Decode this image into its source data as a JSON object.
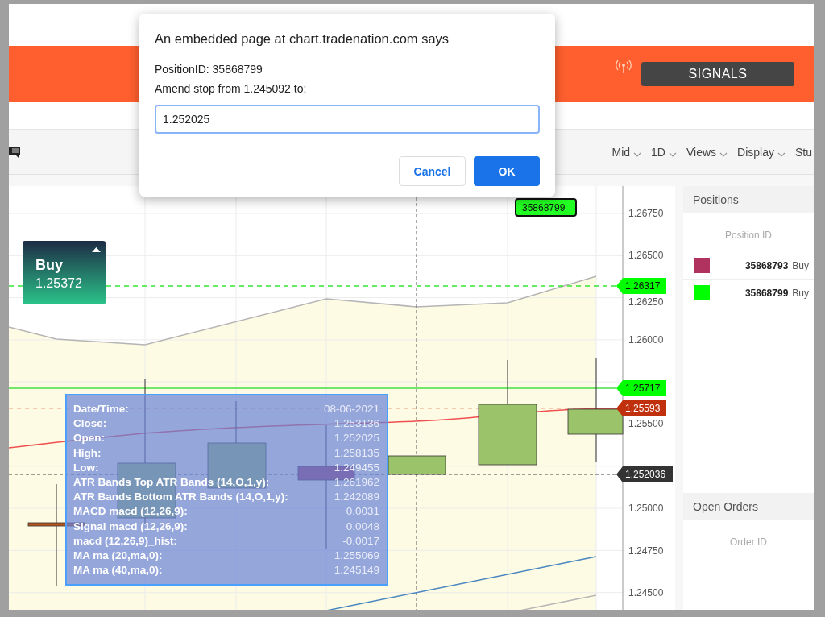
{
  "header": {
    "signals_button": "SIGNALS"
  },
  "toolbar": {
    "menus": [
      "Mid",
      "1D",
      "Views",
      "Display",
      "Stu"
    ]
  },
  "chart": {
    "price_labels": [
      "1.26750",
      "1.26500",
      "1.26250",
      "1.26000",
      "1.25500",
      "1.25000",
      "1.24750",
      "1.24500"
    ],
    "price_tags": [
      {
        "text": "1.26317",
        "color": "#00ff00"
      },
      {
        "text": "1.25717",
        "color": "#00ff00"
      },
      {
        "text": "1.25593",
        "color": "#c0300c"
      },
      {
        "text": "1.252036",
        "color": "#333333"
      }
    ],
    "position_tag": "35868799",
    "buy_box": {
      "label": "Buy",
      "price": "1.25372"
    },
    "tooltip": [
      {
        "label": "Date/Time:",
        "value": "08-06-2021"
      },
      {
        "label": "Close:",
        "value": "1.253136"
      },
      {
        "label": "Open:",
        "value": "1.252025"
      },
      {
        "label": "High:",
        "value": "1.258135"
      },
      {
        "label": "Low:",
        "value": "1.249455"
      },
      {
        "label": "ATR Bands Top ATR Bands (14,O,1,y):",
        "value": "1.261962"
      },
      {
        "label": "ATR Bands Bottom ATR Bands (14,O,1,y):",
        "value": "1.242089"
      },
      {
        "label": "MACD macd (12,26,9):",
        "value": "0.0031"
      },
      {
        "label": "Signal macd (12,26,9):",
        "value": "0.0048"
      },
      {
        "label": "macd (12,26,9)_hist:",
        "value": "-0.0017"
      },
      {
        "label": "MA ma (20,ma,0):",
        "value": "1.255069"
      },
      {
        "label": "MA ma (40,ma,0):",
        "value": "1.245149"
      }
    ]
  },
  "positions": {
    "title": "Positions",
    "column": "Position ID",
    "rows": [
      {
        "id": "35868793",
        "side": "Buy",
        "color": "#b0335f"
      },
      {
        "id": "35868799",
        "side": "Buy",
        "color": "#00ff00"
      }
    ]
  },
  "open_orders": {
    "title": "Open Orders",
    "column": "Order ID"
  },
  "dialog": {
    "title": "An embedded page at chart.tradenation.com says",
    "lines": [
      "PositionID: 35868799",
      "Amend stop from 1.245092 to:"
    ],
    "input_value": "1.252025",
    "buttons": [
      {
        "label": "Cancel",
        "kind": "secondary"
      },
      {
        "label": "OK",
        "kind": "primary"
      }
    ]
  }
}
